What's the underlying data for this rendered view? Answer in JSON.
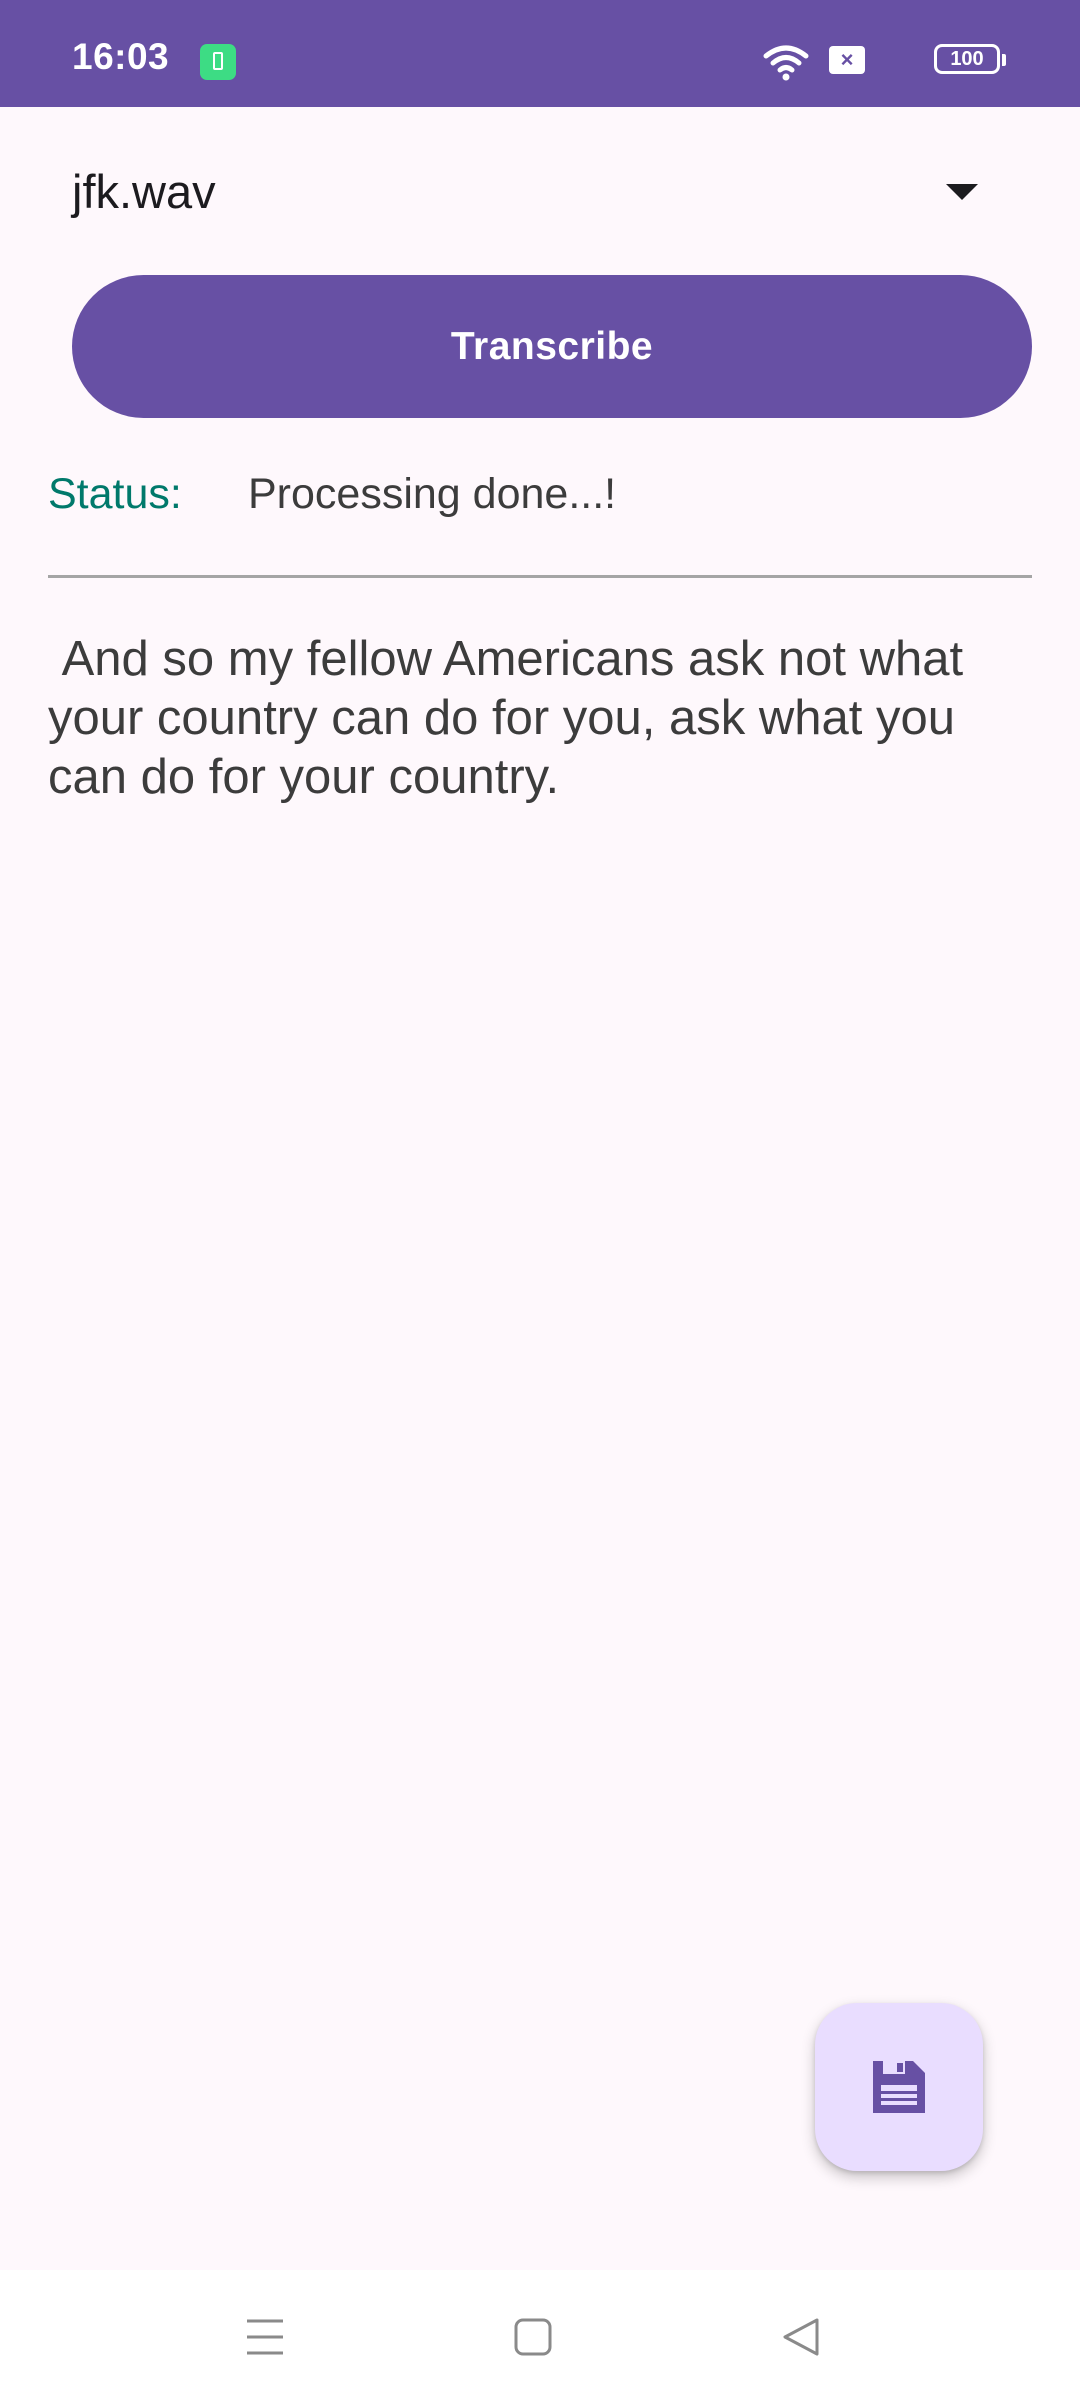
{
  "status_bar": {
    "time": "16:03",
    "battery_level": "100",
    "icons": [
      "battery-saver-icon",
      "wifi-icon",
      "sim-off-icon",
      "battery-icon"
    ]
  },
  "file_selector": {
    "selected": "jfk.wav"
  },
  "transcribe_button": {
    "label": "Transcribe"
  },
  "status": {
    "label": "Status:",
    "value": "Processing done...!"
  },
  "transcript": {
    "text": " And so my fellow Americans ask not what your country can do for you, ask what you can do for your country."
  },
  "fab": {
    "icon": "save-icon"
  },
  "nav_bar": {
    "icons": [
      "menu-icon",
      "home-icon",
      "back-icon"
    ]
  },
  "colors": {
    "primary": "#6750a4",
    "status_label": "#00796b",
    "fab_bg": "#e9ddff",
    "background": "#fef8fc"
  }
}
